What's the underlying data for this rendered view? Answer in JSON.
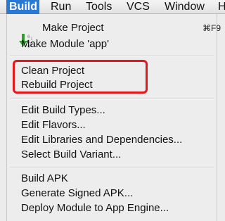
{
  "menubar": {
    "items": [
      {
        "label": "Build",
        "active": true
      },
      {
        "label": "Run"
      },
      {
        "label": "Tools"
      },
      {
        "label": "VCS"
      },
      {
        "label": "Window"
      },
      {
        "label": "H"
      }
    ]
  },
  "menu": {
    "items": [
      {
        "label": "Make Project",
        "shortcut": "⌘F9",
        "icon": "make-project-icon"
      },
      {
        "label": "Make Module 'app'"
      },
      {
        "label": "Clean Project"
      },
      {
        "label": "Rebuild Project"
      },
      {
        "label": "Edit Build Types..."
      },
      {
        "label": "Edit Flavors..."
      },
      {
        "label": "Edit Libraries and Dependencies..."
      },
      {
        "label": "Select Build Variant..."
      },
      {
        "label": "Build APK"
      },
      {
        "label": "Generate Signed APK..."
      },
      {
        "label": "Deploy Module to App Engine..."
      }
    ]
  },
  "colors": {
    "active_menu_bg": "#2a78d6",
    "highlight_border": "#e8151b",
    "arrow_green": "#2f9e2f"
  }
}
